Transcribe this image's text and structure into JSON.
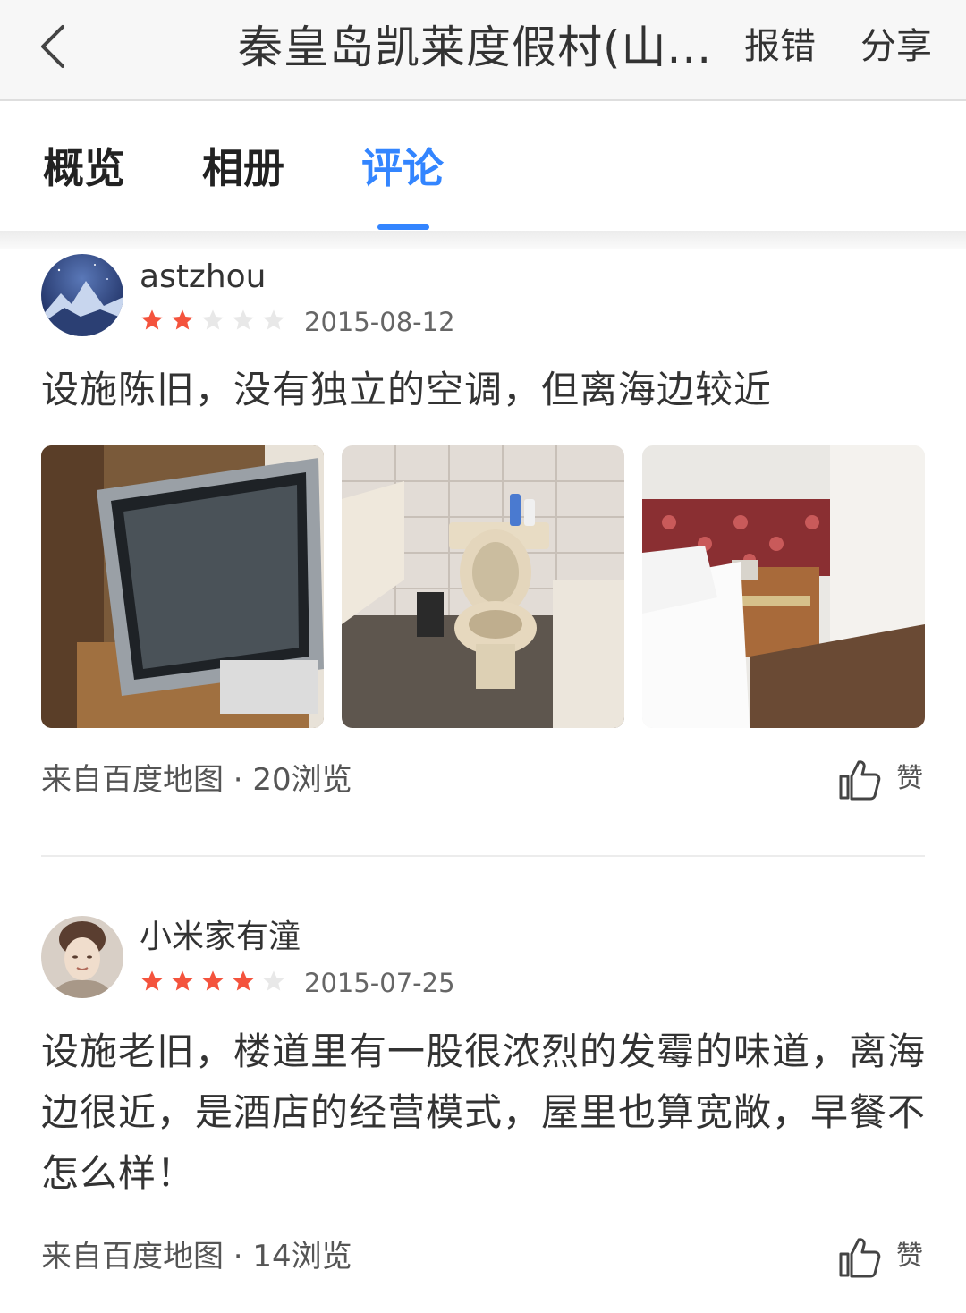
{
  "nav": {
    "title": "秦皇岛凯莱度假村(山...",
    "report_label": "报错",
    "share_label": "分享"
  },
  "tabs": [
    {
      "label": "概览",
      "active": false
    },
    {
      "label": "相册",
      "active": false
    },
    {
      "label": "评论",
      "active": true
    }
  ],
  "colors": {
    "accent": "#3385ff",
    "star_filled": "#f4533d",
    "star_empty": "#e8e8e8"
  },
  "reviews": [
    {
      "username": "astzhou",
      "rating": 2,
      "max_rating": 5,
      "date": "2015-08-12",
      "text": "设施陈旧，没有独立的空调，但离海边较近",
      "photos": [
        {
          "icon": "tv-photo"
        },
        {
          "icon": "toilet-photo"
        },
        {
          "icon": "bed-photo"
        }
      ],
      "source": "来自百度地图 · 20浏览",
      "like_label": "赞"
    },
    {
      "username": "小米家有潼",
      "rating": 4,
      "max_rating": 5,
      "date": "2015-07-25",
      "text": "设施老旧，楼道里有一股很浓烈的发霉的味道，离海边很近，是酒店的经营模式，屋里也算宽敞，早餐不怎么样！",
      "photos": [],
      "source": "来自百度地图 · 14浏览",
      "like_label": "赞"
    }
  ]
}
